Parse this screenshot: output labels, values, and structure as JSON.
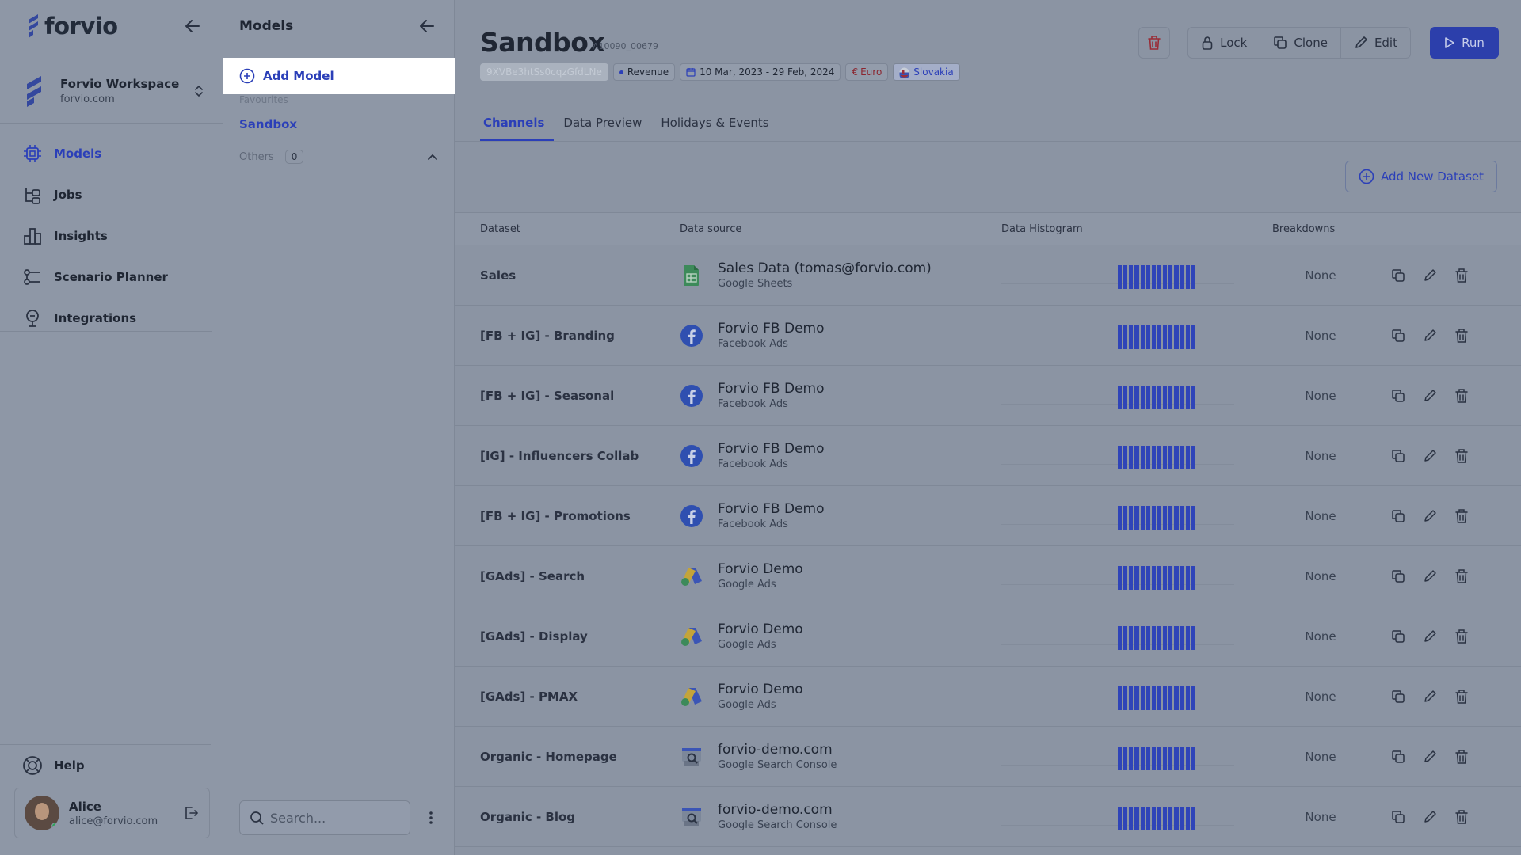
{
  "brand": {
    "name": "forvio"
  },
  "workspace": {
    "name": "Forvio Workspace",
    "domain": "forvio.com"
  },
  "nav": {
    "items": [
      {
        "label": "Models",
        "icon": "models-icon",
        "active": true
      },
      {
        "label": "Jobs",
        "icon": "jobs-icon"
      },
      {
        "label": "Insights",
        "icon": "insights-icon"
      },
      {
        "label": "Scenario Planner",
        "icon": "scenario-icon"
      },
      {
        "label": "Integrations",
        "icon": "integrations-icon"
      }
    ],
    "help_label": "Help"
  },
  "user": {
    "name": "Alice",
    "email": "alice@forvio.com"
  },
  "models_panel": {
    "title": "Models",
    "add_label": "Add Model",
    "favourites_label": "Favourites",
    "favourite_item": "Sandbox",
    "others_label": "Others",
    "others_count": "0",
    "search_placeholder": "Search..."
  },
  "page": {
    "title": "Sandbox",
    "id": "A10090_00679",
    "chips": {
      "key": "9XVBe3htSs0cqzGfdLNe",
      "metric": "Revenue",
      "date_range": "10 Mar, 2023 - 29 Feb, 2024",
      "currency": "Euro",
      "country": "Slovakia"
    },
    "actions": {
      "lock": "Lock",
      "clone": "Clone",
      "edit": "Edit",
      "run": "Run"
    },
    "tabs": [
      "Channels",
      "Data Preview",
      "Holidays & Events"
    ],
    "add_dataset_label": "Add New Dataset"
  },
  "table": {
    "headers": {
      "dataset": "Dataset",
      "source": "Data source",
      "histogram": "Data Histogram",
      "breakdowns": "Breakdowns"
    },
    "rows": [
      {
        "dataset": "Sales",
        "source": "Sales Data (tomas@forvio.com)",
        "type": "Google Sheets",
        "icon": "google-sheets-icon",
        "breakdowns": "None"
      },
      {
        "dataset": "[FB + IG] - Branding",
        "source": "Forvio FB Demo",
        "type": "Facebook Ads",
        "icon": "facebook-icon",
        "breakdowns": "None"
      },
      {
        "dataset": "[FB + IG] - Seasonal",
        "source": "Forvio FB Demo",
        "type": "Facebook Ads",
        "icon": "facebook-icon",
        "breakdowns": "None"
      },
      {
        "dataset": "[IG] - Influencers Collab",
        "source": "Forvio FB Demo",
        "type": "Facebook Ads",
        "icon": "facebook-icon",
        "breakdowns": "None"
      },
      {
        "dataset": "[FB + IG] - Promotions",
        "source": "Forvio FB Demo",
        "type": "Facebook Ads",
        "icon": "facebook-icon",
        "breakdowns": "None"
      },
      {
        "dataset": "[GAds] - Search",
        "source": "Forvio Demo",
        "type": "Google Ads",
        "icon": "google-ads-icon",
        "breakdowns": "None"
      },
      {
        "dataset": "[GAds] - Display",
        "source": "Forvio Demo",
        "type": "Google Ads",
        "icon": "google-ads-icon",
        "breakdowns": "None"
      },
      {
        "dataset": "[GAds] - PMAX",
        "source": "Forvio Demo",
        "type": "Google Ads",
        "icon": "google-ads-icon",
        "breakdowns": "None"
      },
      {
        "dataset": "Organic - Homepage",
        "source": "forvio-demo.com",
        "type": "Google Search Console",
        "icon": "search-console-icon",
        "breakdowns": "None"
      },
      {
        "dataset": "Organic - Blog",
        "source": "forvio-demo.com",
        "type": "Google Search Console",
        "icon": "search-console-icon",
        "breakdowns": "None"
      }
    ]
  },
  "colors": {
    "accent": "#2b3fb8",
    "overlay": "#8b94a3",
    "facebook": "#2f4fb0"
  }
}
